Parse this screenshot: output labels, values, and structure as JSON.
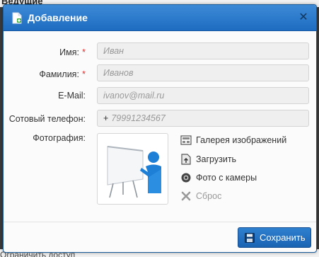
{
  "background": {
    "top_partial_text": "Ведущие",
    "bottom_partial_text": "Ограничить доступ"
  },
  "dialog": {
    "title": "Добавление",
    "fields": {
      "first_name": {
        "label": "Имя:",
        "placeholder": "Иван",
        "required": true
      },
      "last_name": {
        "label": "Фамилия:",
        "placeholder": "Иванов",
        "required": true
      },
      "email": {
        "label": "E-Mail:",
        "placeholder": "ivanov@mail.ru",
        "required": false
      },
      "phone": {
        "label": "Сотовый телефон:",
        "prefix": "+",
        "placeholder": "79991234567",
        "required": false
      }
    },
    "required_mark": "*",
    "photo": {
      "label": "Фотография:",
      "actions": {
        "gallery": "Галерея изображений",
        "upload": "Загрузить",
        "camera": "Фото с камеры",
        "reset": "Сброс"
      }
    },
    "save_label": "Сохранить"
  },
  "colors": {
    "title_bar": "#2a78cc",
    "required": "#d33333",
    "save_button": "#1f6bbf"
  }
}
